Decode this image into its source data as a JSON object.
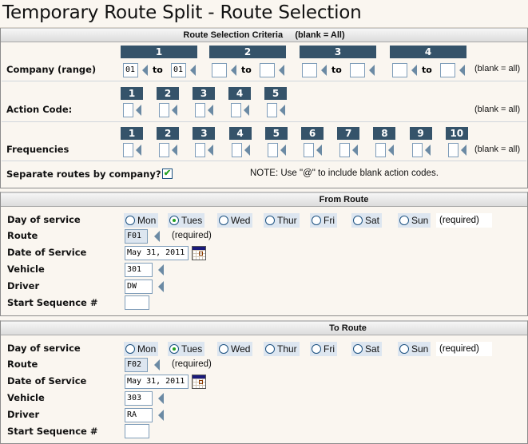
{
  "page": {
    "title": "Temporary Route Split - Route Selection"
  },
  "criteria": {
    "header": "Route Selection Criteria     (blank = All)",
    "company": {
      "label": "Company (range)",
      "groups": [
        {
          "header": "1",
          "from": "01",
          "to": "01"
        },
        {
          "header": "2",
          "from": "",
          "to": ""
        },
        {
          "header": "3",
          "from": "",
          "to": ""
        },
        {
          "header": "4",
          "from": "",
          "to": ""
        }
      ],
      "to_label": "to",
      "hint": "(blank = all)"
    },
    "action_code": {
      "label": "Action Code:",
      "headers": [
        "1",
        "2",
        "3",
        "4",
        "5"
      ],
      "values": [
        "",
        "",
        "",
        "",
        ""
      ],
      "hint": "(blank = all)"
    },
    "frequencies": {
      "label": "Frequencies",
      "headers": [
        "1",
        "2",
        "3",
        "4",
        "5",
        "6",
        "7",
        "8",
        "9",
        "10"
      ],
      "values": [
        "",
        "",
        "",
        "",
        "",
        "",
        "",
        "",
        "",
        ""
      ],
      "hint": "(blank = all)"
    },
    "separate": {
      "label": "Separate routes by company?",
      "checked": true,
      "check_glyph": "✔"
    },
    "note": "NOTE: Use \"@\" to include blank action codes."
  },
  "from_route": {
    "header": "From Route",
    "day_label": "Day of service",
    "days": [
      {
        "label": "Mon",
        "checked": false
      },
      {
        "label": "Tues",
        "checked": true
      },
      {
        "label": "Wed",
        "checked": false
      },
      {
        "label": "Thur",
        "checked": false
      },
      {
        "label": "Fri",
        "checked": false
      },
      {
        "label": "Sat",
        "checked": false
      },
      {
        "label": "Sun",
        "checked": false
      }
    ],
    "day_required": "(required)",
    "route_label": "Route",
    "route_value": "F01",
    "route_required": "(required)",
    "date_label": "Date of Service",
    "date_value": "May 31, 2011",
    "vehicle_label": "Vehicle",
    "vehicle_value": "301",
    "driver_label": "Driver",
    "driver_value": "DW",
    "seq_label": "Start Sequence #",
    "seq_value": ""
  },
  "to_route": {
    "header": "To Route",
    "day_label": "Day of service",
    "days": [
      {
        "label": "Mon",
        "checked": false
      },
      {
        "label": "Tues",
        "checked": true
      },
      {
        "label": "Wed",
        "checked": false
      },
      {
        "label": "Thur",
        "checked": false
      },
      {
        "label": "Fri",
        "checked": false
      },
      {
        "label": "Sat",
        "checked": false
      },
      {
        "label": "Sun",
        "checked": false
      }
    ],
    "day_required": "(required)",
    "route_label": "Route",
    "route_value": "F02",
    "route_required": "(required)",
    "date_label": "Date of Service",
    "date_value": "May 31, 2011",
    "vehicle_label": "Vehicle",
    "vehicle_value": "303",
    "driver_label": "Driver",
    "driver_value": "RA",
    "seq_label": "Start Sequence #",
    "seq_value": ""
  }
}
